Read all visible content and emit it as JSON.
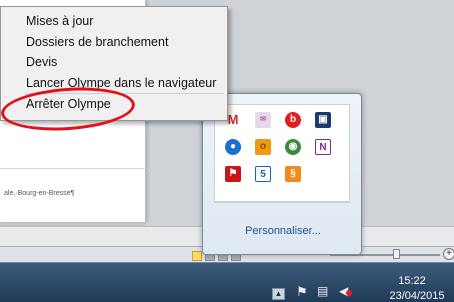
{
  "context_menu": {
    "items": [
      {
        "label": "Mises à jour"
      },
      {
        "label": "Dossiers de branchement"
      },
      {
        "label": "Devis"
      },
      {
        "label": "Lancer Olympe dans le navigateur"
      },
      {
        "label": "Arrêter Olympe",
        "highlighted_by_annotation": true
      }
    ]
  },
  "background_document": {
    "address_fragment": "ale,·Bourg-en-Bresse¶"
  },
  "tray_flyout": {
    "icons": [
      [
        "gmail-notifier-icon",
        "mail-envelope-icon",
        "beats-audio-icon",
        "screen-monitor-icon"
      ],
      [
        "cloud-sync-icon",
        "orange-square-icon",
        "chrome-like-icon",
        "onenote-icon"
      ],
      [
        "acrobat-pdf-icon",
        "html5-shield-icon",
        "java-icon"
      ]
    ],
    "icon_glyphs": [
      [
        "M",
        "✉",
        "b",
        "▣"
      ],
      [
        "●",
        "o",
        "◉",
        "N"
      ],
      [
        "⚑",
        "5",
        "§"
      ]
    ],
    "customize_link": "Personnaliser..."
  },
  "taskbar": {
    "time": "15:22",
    "date": "23/04/2015",
    "colors": {
      "start": "#3d5c7d",
      "end": "#1f3a57"
    }
  },
  "annotation": {
    "color": "#e3101a"
  }
}
